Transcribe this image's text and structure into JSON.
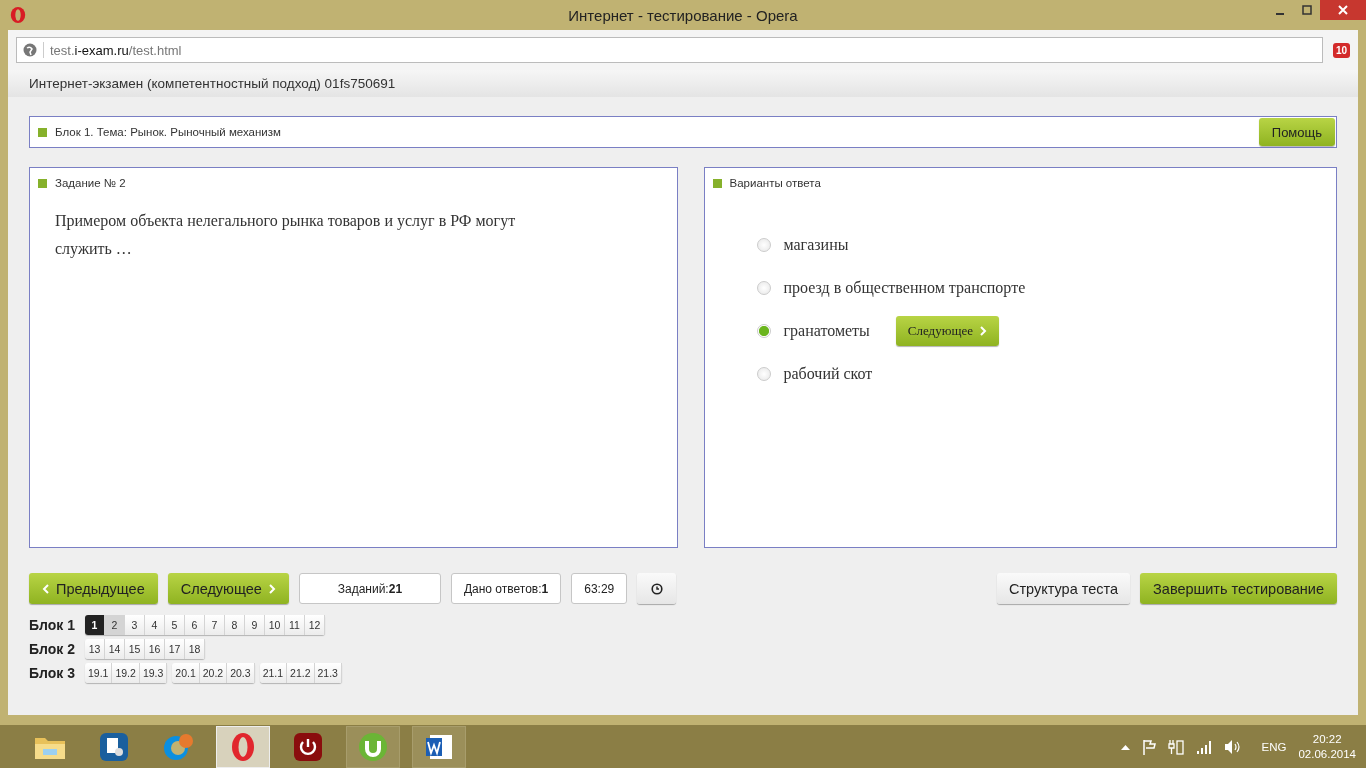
{
  "window": {
    "title": "Интернет - тестирование - Opera"
  },
  "address": {
    "prefix": "test.",
    "domain": "i-exam.ru",
    "path": "/test.html"
  },
  "opera_badge": "10",
  "page_header": "Интернет-экзамен (компетентностный подход) 01fs750691",
  "topic": {
    "label": "Блок 1. Тема: Рынок. Рыночный механизм",
    "help_button": "Помощь"
  },
  "task": {
    "title": "Задание № 2",
    "text": "Примером объекта нелегального рынка товаров и услуг в РФ могут служить …"
  },
  "answers": {
    "title": "Варианты ответа",
    "next_button": "Следующее",
    "options": [
      {
        "label": "магазины",
        "selected": false
      },
      {
        "label": "проезд в общественном транспорте",
        "selected": false
      },
      {
        "label": "гранатометы",
        "selected": true
      },
      {
        "label": "рабочий скот",
        "selected": false
      }
    ]
  },
  "nav": {
    "prev": "Предыдущее",
    "next": "Следующее",
    "tasks_label": "Заданий:",
    "tasks_count": "21",
    "answered_label": "Дано ответов:",
    "answered_count": "1",
    "timer": "63:29",
    "structure": "Структура теста",
    "finish": "Завершить тестирование"
  },
  "blocks": [
    {
      "label": "Блок 1",
      "groups": [
        [
          {
            "label": "1",
            "selected": true,
            "visited": false
          },
          {
            "label": "2",
            "selected": false,
            "visited": true
          },
          {
            "label": "3",
            "selected": false,
            "visited": false
          },
          {
            "label": "4",
            "selected": false,
            "visited": false
          },
          {
            "label": "5",
            "selected": false,
            "visited": false
          },
          {
            "label": "6",
            "selected": false,
            "visited": false
          },
          {
            "label": "7",
            "selected": false,
            "visited": false
          },
          {
            "label": "8",
            "selected": false,
            "visited": false
          },
          {
            "label": "9",
            "selected": false,
            "visited": false
          },
          {
            "label": "10",
            "selected": false,
            "visited": false
          },
          {
            "label": "11",
            "selected": false,
            "visited": false
          },
          {
            "label": "12",
            "selected": false,
            "visited": false
          }
        ]
      ]
    },
    {
      "label": "Блок 2",
      "groups": [
        [
          {
            "label": "13",
            "selected": false,
            "visited": false
          },
          {
            "label": "14",
            "selected": false,
            "visited": false
          },
          {
            "label": "15",
            "selected": false,
            "visited": false
          },
          {
            "label": "16",
            "selected": false,
            "visited": false
          },
          {
            "label": "17",
            "selected": false,
            "visited": false
          },
          {
            "label": "18",
            "selected": false,
            "visited": false
          }
        ]
      ]
    },
    {
      "label": "Блок 3",
      "groups": [
        [
          {
            "label": "19.1",
            "selected": false,
            "visited": false
          },
          {
            "label": "19.2",
            "selected": false,
            "visited": false
          },
          {
            "label": "19.3",
            "selected": false,
            "visited": false
          }
        ],
        [
          {
            "label": "20.1",
            "selected": false,
            "visited": false
          },
          {
            "label": "20.2",
            "selected": false,
            "visited": false
          },
          {
            "label": "20.3",
            "selected": false,
            "visited": false
          }
        ],
        [
          {
            "label": "21.1",
            "selected": false,
            "visited": false
          },
          {
            "label": "21.2",
            "selected": false,
            "visited": false
          },
          {
            "label": "21.3",
            "selected": false,
            "visited": false
          }
        ]
      ]
    }
  ],
  "taskbar": {
    "lang": "ENG",
    "time": "20:22",
    "date": "02.06.2014"
  }
}
